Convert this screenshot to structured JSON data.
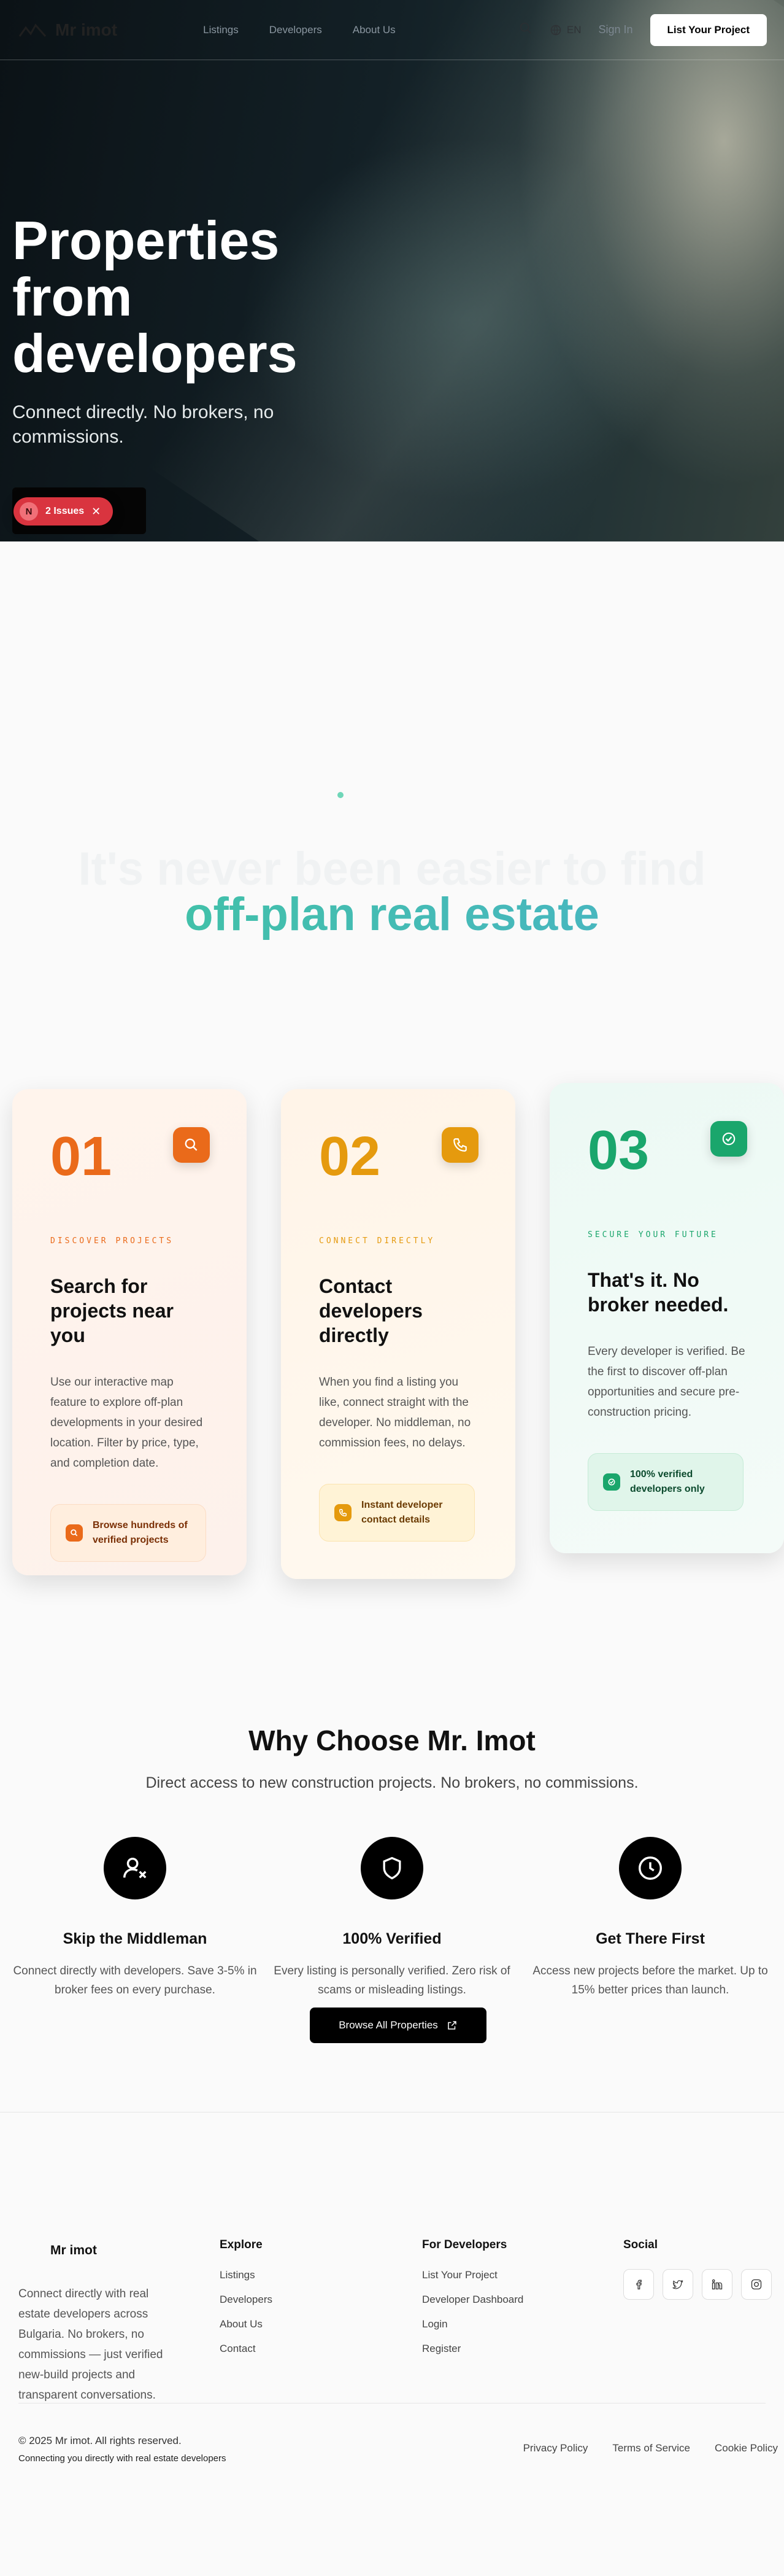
{
  "nav": {
    "logo_text": "Mr imot",
    "links": [
      "Listings",
      "Developers",
      "About Us"
    ],
    "lang": "EN",
    "signin": "Sign In",
    "cta": "List Your Project"
  },
  "hero": {
    "title": "Properties from developers",
    "subtitle": "Connect directly. No brokers, no commissions.",
    "button_text": "?",
    "issues_badge": {
      "letter": "N",
      "label": "2 Issues"
    }
  },
  "intro": {
    "title_line1": "It's never been easier to find",
    "title_line2": "off-plan real estate"
  },
  "steps": [
    {
      "num": "01",
      "kicker": "DISCOVER PROJECTS",
      "title": "Search for projects near you",
      "text": "Use our interactive map feature to explore off-plan developments in your desired location. Filter by price, type, and completion date.",
      "chip": "Browse hundreds of verified projects",
      "accent": "#ea6a1a",
      "icon": "search-icon"
    },
    {
      "num": "02",
      "kicker": "CONNECT DIRECTLY",
      "title": "Contact developers directly",
      "text": "When you find a listing you like, connect straight with the developer. No middleman, no commission fees, no delays.",
      "chip": "Instant developer contact details",
      "accent": "#e59a0e",
      "icon": "phone-icon"
    },
    {
      "num": "03",
      "kicker": "SECURE YOUR FUTURE",
      "title": "That's it. No broker needed.",
      "text": "Every developer is verified. Be the first to discover off-plan opportunities and secure pre-construction pricing.",
      "chip": "100% verified developers only",
      "accent": "#1aa66c",
      "icon": "check-badge-icon"
    }
  ],
  "why": {
    "title": "Why Choose Mr. Imot",
    "lead": "Direct access to new construction projects. No brokers, no commissions.",
    "features": [
      {
        "title": "Skip the Middleman",
        "text": "Connect directly with developers. Save 3-5% in broker fees on every purchase.",
        "icon": "user-x-icon"
      },
      {
        "title": "100% Verified",
        "text": "Every listing is personally verified. Zero risk of scams or misleading listings.",
        "icon": "shield-icon"
      },
      {
        "title": "Get There First",
        "text": "Access new projects before the market. Up to 15% better prices than launch.",
        "icon": "clock-icon"
      }
    ],
    "browse": "Browse All Properties"
  },
  "footer": {
    "brand": "Mr imot",
    "about": "Connect directly with real estate developers across Bulgaria. No brokers, no commissions — just verified new-build projects and transparent conversations.",
    "explore_title": "Explore",
    "explore": [
      "Listings",
      "Developers",
      "About Us",
      "Contact"
    ],
    "dev_title": "For Developers",
    "dev": [
      "List Your Project",
      "Developer Dashboard",
      "Login",
      "Register"
    ],
    "social_title": "Social",
    "social": [
      "facebook-icon",
      "twitter-icon",
      "linkedin-icon",
      "instagram-icon"
    ],
    "copyright": "© 2025 Mr imot. All rights reserved.",
    "tagline": "Connecting you directly with real estate developers",
    "legal": [
      "Privacy Policy",
      "Terms of Service",
      "Cookie Policy"
    ]
  }
}
